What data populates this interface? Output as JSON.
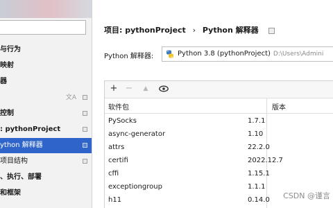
{
  "sidebar": {
    "items": [
      {
        "label": "与行为"
      },
      {
        "label": "映射"
      },
      {
        "label": "器"
      },
      {
        "label": "",
        "lang": "文A"
      },
      {
        "label": "控制"
      },
      {
        "label": ": pythonProject"
      },
      {
        "label": "ython 解释器",
        "selected": true
      },
      {
        "label": "项目结构"
      },
      {
        "label": "、执行、部署"
      },
      {
        "label": "和框架"
      }
    ]
  },
  "breadcrumb": {
    "project": "项目: pythonProject",
    "separator": "›",
    "page": "Python 解释器"
  },
  "interpreter": {
    "label": "Python 解释器:",
    "name": "Python 3.8 (pythonProject)",
    "path": "D:\\Users\\Admini"
  },
  "toolbar": {
    "add": "+",
    "remove": "−",
    "up": "▲"
  },
  "packages": {
    "headers": [
      "软件包",
      "版本"
    ],
    "rows": [
      {
        "name": "PySocks",
        "version": "1.7.1"
      },
      {
        "name": "async-generator",
        "version": "1.10"
      },
      {
        "name": "attrs",
        "version": "22.2.0"
      },
      {
        "name": "certifi",
        "version": "2022.12.7"
      },
      {
        "name": "cffi",
        "version": "1.15.1"
      },
      {
        "name": "exceptiongroup",
        "version": "1.1.1"
      },
      {
        "name": "h11",
        "version": "0.14.0"
      }
    ]
  },
  "watermark": "CSDN @谨言",
  "colors": {
    "selection": "#2f65ca",
    "sidebar_bg": "#f2f2f2"
  }
}
